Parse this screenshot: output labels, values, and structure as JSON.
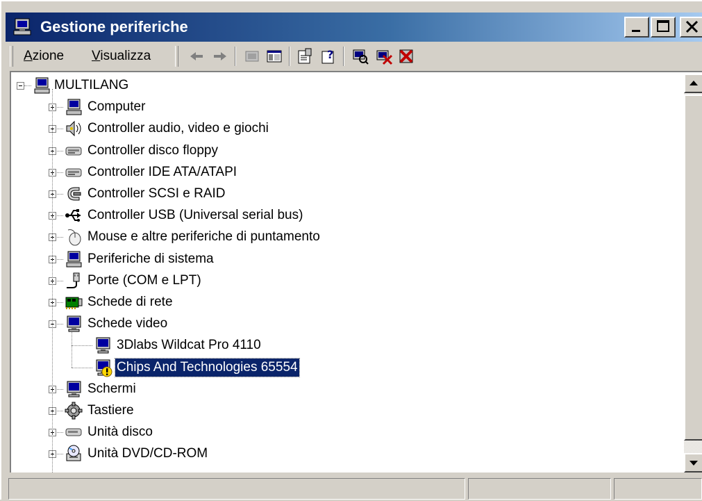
{
  "window": {
    "title": "Gestione periferiche"
  },
  "menu": [
    {
      "label": "Azione",
      "accel_index": 0
    },
    {
      "label": "Visualizza",
      "accel_index": 0
    }
  ],
  "toolbar": [
    "back-arrow-icon",
    "forward-arrow-icon",
    "up-level-icon",
    "show-hide-tree-icon",
    "properties-icon",
    "help-icon",
    "scan-hardware-icon",
    "uninstall-icon",
    "disable-icon"
  ],
  "tree": {
    "root": {
      "label": "MULTILANG",
      "icon": "computer-icon",
      "expanded": true
    },
    "items": [
      {
        "label": "Computer",
        "icon": "computer-icon",
        "expanded": false
      },
      {
        "label": "Controller audio, video e giochi",
        "icon": "speaker-icon",
        "expanded": false
      },
      {
        "label": "Controller disco floppy",
        "icon": "floppy-controller-icon",
        "expanded": false
      },
      {
        "label": "Controller IDE ATA/ATAPI",
        "icon": "ide-controller-icon",
        "expanded": false
      },
      {
        "label": "Controller SCSI e RAID",
        "icon": "scsi-icon",
        "expanded": false
      },
      {
        "label": "Controller USB (Universal serial bus)",
        "icon": "usb-icon",
        "expanded": false
      },
      {
        "label": "Mouse e altre periferiche di puntamento",
        "icon": "mouse-icon",
        "expanded": false
      },
      {
        "label": "Periferiche di sistema",
        "icon": "computer-icon",
        "expanded": false
      },
      {
        "label": "Porte (COM e LPT)",
        "icon": "port-icon",
        "expanded": false
      },
      {
        "label": "Schede di rete",
        "icon": "network-card-icon",
        "expanded": false
      },
      {
        "label": "Schede video",
        "icon": "monitor-icon",
        "expanded": true,
        "children": [
          {
            "label": "3Dlabs Wildcat Pro 4110",
            "icon": "monitor-icon",
            "selected": false,
            "warning": false
          },
          {
            "label": "Chips And Technologies 65554",
            "icon": "monitor-icon",
            "selected": true,
            "warning": true
          }
        ]
      },
      {
        "label": "Schermi",
        "icon": "monitor-icon",
        "expanded": false
      },
      {
        "label": "Tastiere",
        "icon": "keyboard-icon",
        "expanded": false
      },
      {
        "label": "Unità disco",
        "icon": "disk-drive-icon",
        "expanded": false
      },
      {
        "label": "Unità DVD/CD-ROM",
        "icon": "cdrom-icon",
        "expanded": false
      }
    ]
  },
  "colors": {
    "titlebar_start": "#0a246a",
    "titlebar_end": "#a6caf0",
    "selection": "#0a246a",
    "face": "#d4d0c8"
  }
}
